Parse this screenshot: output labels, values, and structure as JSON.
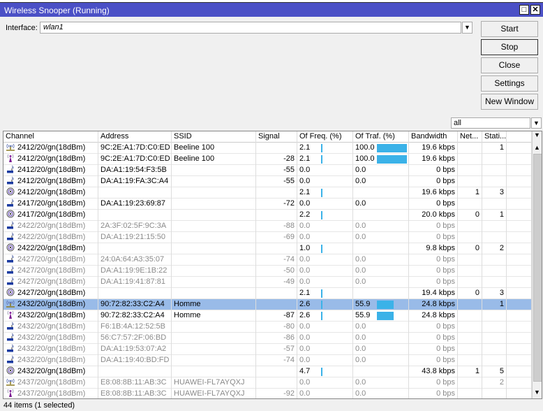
{
  "window": {
    "title": "Wireless Snooper (Running)"
  },
  "interface": {
    "label": "Interface:",
    "value": "wlan1"
  },
  "buttons": {
    "start": "Start",
    "stop": "Stop",
    "close": "Close",
    "settings": "Settings",
    "new_window": "New Window"
  },
  "filter": {
    "value": "all"
  },
  "columns": [
    "Channel",
    "Address",
    "SSID",
    "Signal",
    "Of Freq. (%)",
    "Of Traf. (%)",
    "Bandwidth",
    "Net...",
    "Stati..."
  ],
  "colors": {
    "titlebar": "#4b50c6",
    "bar": "#3bb2e8",
    "selected": "#99bbe8"
  },
  "rows": [
    {
      "icon": "network-icon",
      "channel": "2412/20/gn(18dBm)",
      "address": "9C:2E:A1:7D:C0:ED",
      "ssid": "Beeline 100",
      "signal": "",
      "freq": "2.1",
      "traf": "100.0",
      "traf_pct": 100,
      "bw": "19.6 kbps",
      "net": "",
      "sta": "1",
      "dim": false
    },
    {
      "icon": "ap-icon",
      "channel": "2412/20/gn(18dBm)",
      "address": "9C:2E:A1:7D:C0:ED",
      "ssid": "Beeline 100",
      "signal": "-28",
      "freq": "2.1",
      "traf": "100.0",
      "traf_pct": 100,
      "bw": "19.6 kbps",
      "net": "",
      "sta": "",
      "dim": false
    },
    {
      "icon": "client-icon",
      "channel": "2412/20/gn(18dBm)",
      "address": "DA:A1:19:54:F3:5B",
      "ssid": "",
      "signal": "-55",
      "freq": "0.0",
      "traf": "0.0",
      "bw": "0 bps",
      "net": "",
      "sta": "",
      "dim": false
    },
    {
      "icon": "client-icon",
      "channel": "2412/20/gn(18dBm)",
      "address": "DA:A1:19:FA:3C:A4",
      "ssid": "",
      "signal": "-55",
      "freq": "0.0",
      "traf": "0.0",
      "bw": "0 bps",
      "net": "",
      "sta": "",
      "dim": false
    },
    {
      "icon": "channel-icon",
      "channel": "2412/20/gn(18dBm)",
      "address": "",
      "ssid": "",
      "signal": "",
      "freq": "2.1",
      "traf": "",
      "bw": "19.6 kbps",
      "net": "1",
      "sta": "3",
      "dim": false
    },
    {
      "icon": "client-icon",
      "channel": "2417/20/gn(18dBm)",
      "address": "DA:A1:19:23:69:87",
      "ssid": "",
      "signal": "-72",
      "freq": "0.0",
      "traf": "0.0",
      "bw": "0 bps",
      "net": "",
      "sta": "",
      "dim": false
    },
    {
      "icon": "channel-icon",
      "channel": "2417/20/gn(18dBm)",
      "address": "",
      "ssid": "",
      "signal": "",
      "freq": "2.2",
      "traf": "",
      "bw": "20.0 kbps",
      "net": "0",
      "sta": "1",
      "dim": false
    },
    {
      "icon": "client-icon",
      "channel": "2422/20/gn(18dBm)",
      "address": "2A:3F:02:5F:9C:3A",
      "ssid": "",
      "signal": "-88",
      "freq": "0.0",
      "traf": "0.0",
      "bw": "0 bps",
      "net": "",
      "sta": "",
      "dim": true
    },
    {
      "icon": "client-icon",
      "channel": "2422/20/gn(18dBm)",
      "address": "DA:A1:19:21:15:50",
      "ssid": "",
      "signal": "-69",
      "freq": "0.0",
      "traf": "0.0",
      "bw": "0 bps",
      "net": "",
      "sta": "",
      "dim": true
    },
    {
      "icon": "channel-icon",
      "channel": "2422/20/gn(18dBm)",
      "address": "",
      "ssid": "",
      "signal": "",
      "freq": "1.0",
      "traf": "",
      "bw": "9.8 kbps",
      "net": "0",
      "sta": "2",
      "dim": false
    },
    {
      "icon": "client-icon",
      "channel": "2427/20/gn(18dBm)",
      "address": "24:0A:64:A3:35:07",
      "ssid": "",
      "signal": "-74",
      "freq": "0.0",
      "traf": "0.0",
      "bw": "0 bps",
      "net": "",
      "sta": "",
      "dim": true
    },
    {
      "icon": "client-icon",
      "channel": "2427/20/gn(18dBm)",
      "address": "DA:A1:19:9E:1B:22",
      "ssid": "",
      "signal": "-50",
      "freq": "0.0",
      "traf": "0.0",
      "bw": "0 bps",
      "net": "",
      "sta": "",
      "dim": true
    },
    {
      "icon": "client-icon",
      "channel": "2427/20/gn(18dBm)",
      "address": "DA:A1:19:41:87:81",
      "ssid": "",
      "signal": "-49",
      "freq": "0.0",
      "traf": "0.0",
      "bw": "0 bps",
      "net": "",
      "sta": "",
      "dim": true
    },
    {
      "icon": "channel-icon",
      "channel": "2427/20/gn(18dBm)",
      "address": "",
      "ssid": "",
      "signal": "",
      "freq": "2.1",
      "traf": "",
      "bw": "19.4 kbps",
      "net": "0",
      "sta": "3",
      "dim": false
    },
    {
      "icon": "network-icon",
      "channel": "2432/20/gn(18dBm)",
      "address": "90:72:82:33:C2:A4",
      "ssid": "Homme",
      "signal": "",
      "freq": "2.6",
      "traf": "55.9",
      "traf_pct": 55.9,
      "bw": "24.8 kbps",
      "net": "",
      "sta": "1",
      "dim": false,
      "selected": true
    },
    {
      "icon": "ap-icon",
      "channel": "2432/20/gn(18dBm)",
      "address": "90:72:82:33:C2:A4",
      "ssid": "Homme",
      "signal": "-87",
      "freq": "2.6",
      "traf": "55.9",
      "traf_pct": 55.9,
      "bw": "24.8 kbps",
      "net": "",
      "sta": "",
      "dim": false
    },
    {
      "icon": "client-icon",
      "channel": "2432/20/gn(18dBm)",
      "address": "F6:1B:4A:12:52:5B",
      "ssid": "",
      "signal": "-80",
      "freq": "0.0",
      "traf": "0.0",
      "bw": "0 bps",
      "net": "",
      "sta": "",
      "dim": true
    },
    {
      "icon": "client-icon",
      "channel": "2432/20/gn(18dBm)",
      "address": "56:C7:57:2F:06:BD",
      "ssid": "",
      "signal": "-86",
      "freq": "0.0",
      "traf": "0.0",
      "bw": "0 bps",
      "net": "",
      "sta": "",
      "dim": true
    },
    {
      "icon": "client-icon",
      "channel": "2432/20/gn(18dBm)",
      "address": "DA:A1:19:53:07:A2",
      "ssid": "",
      "signal": "-57",
      "freq": "0.0",
      "traf": "0.0",
      "bw": "0 bps",
      "net": "",
      "sta": "",
      "dim": true
    },
    {
      "icon": "client-icon",
      "channel": "2432/20/gn(18dBm)",
      "address": "DA:A1:19:40:BD:FD",
      "ssid": "",
      "signal": "-74",
      "freq": "0.0",
      "traf": "0.0",
      "bw": "0 bps",
      "net": "",
      "sta": "",
      "dim": true
    },
    {
      "icon": "channel-icon",
      "channel": "2432/20/gn(18dBm)",
      "address": "",
      "ssid": "",
      "signal": "",
      "freq": "4.7",
      "traf": "",
      "bw": "43.8 kbps",
      "net": "1",
      "sta": "5",
      "dim": false
    },
    {
      "icon": "network-icon",
      "channel": "2437/20/gn(18dBm)",
      "address": "E8:08:8B:11:AB:3C",
      "ssid": "HUAWEI-FL7AYQXJ",
      "signal": "",
      "freq": "0.0",
      "traf": "0.0",
      "bw": "0 bps",
      "net": "",
      "sta": "2",
      "dim": true
    },
    {
      "icon": "ap-icon",
      "channel": "2437/20/gn(18dBm)",
      "address": "E8:08:8B:11:AB:3C",
      "ssid": "HUAWEI-FL7AYQXJ",
      "signal": "-92",
      "freq": "0.0",
      "traf": "0.0",
      "bw": "0 bps",
      "net": "",
      "sta": "",
      "dim": true
    }
  ],
  "status": "44 items (1 selected)"
}
